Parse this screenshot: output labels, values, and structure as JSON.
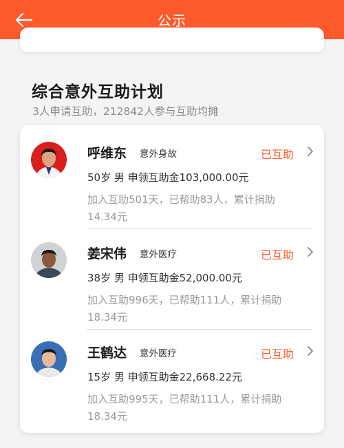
{
  "header": {
    "title": "公示"
  },
  "plan": {
    "title": "综合意外互助计划",
    "subtitle": "3人申请互助，212842人参与互助均摊"
  },
  "entries": [
    {
      "name": "呼维东",
      "tag": "意外身故",
      "status": "已互助",
      "summary": "50岁 男 申领互助金103,000.00元",
      "detail": "加入互助501天，已帮助83人，累计捐助14.34元"
    },
    {
      "name": "姜宋伟",
      "tag": "意外医疗",
      "status": "已互助",
      "summary": "38岁 男 申领互助金52,000.00元",
      "detail": "加入互助996天，已帮助111人，累计捐助18.34元"
    },
    {
      "name": "王鹤达",
      "tag": "意外医疗",
      "status": "已互助",
      "summary": "15岁 男 申领互助金22,668.22元",
      "detail": "加入互助995天，已帮助111人，累计捐助18.34元"
    }
  ],
  "colors": {
    "accent": "#ff5a2c",
    "background": "#f4f4f4"
  },
  "icons": {
    "back": "arrow-left-icon",
    "chevron": "chevron-right-icon"
  }
}
